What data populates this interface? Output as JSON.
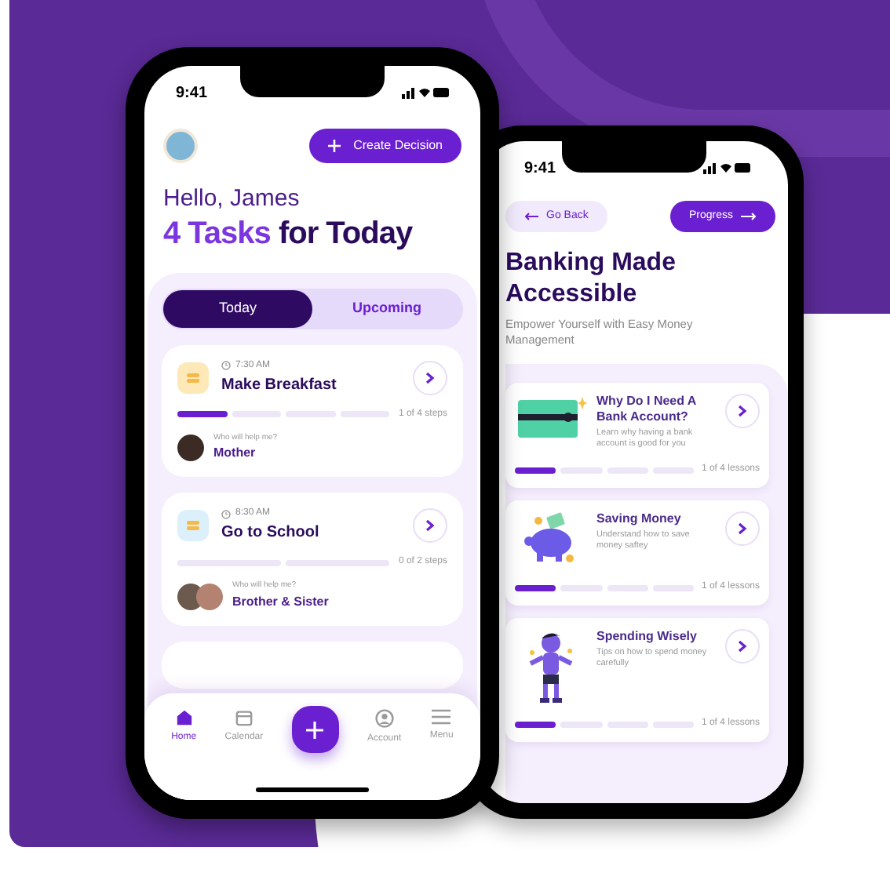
{
  "home_phone": {
    "status_time": "9:41",
    "create_button": "Create Decision",
    "greeting": "Hello, James",
    "headline_accent": "4 Tasks",
    "headline_rest": "for Today",
    "tabs": [
      {
        "label": "Today",
        "selected": true
      },
      {
        "label": "Upcoming",
        "selected": false
      }
    ],
    "tasks": [
      {
        "time": "7:30 AM",
        "title": "Make Breakfast",
        "color": "#fde9b8",
        "segments": [
          {
            "done": true
          },
          {
            "done": false
          },
          {
            "done": false
          },
          {
            "done": false
          }
        ],
        "steps": "1 of 4 steps",
        "helper_prompt": "Who will help me?",
        "helper": "Mother",
        "avatars": [
          {
            "color": "#3c2b24"
          }
        ]
      },
      {
        "time": "8:30 AM",
        "title": "Go to School",
        "color": "#dcf0fb",
        "segments": [
          {
            "done": false
          },
          {
            "done": false
          }
        ],
        "steps": "0 of 2 steps",
        "helper_prompt": "Who will help me?",
        "helper": "Brother & Sister",
        "avatars": [
          {
            "color": "#6b5a4d"
          },
          {
            "color": "#b48270"
          }
        ]
      }
    ],
    "nav": [
      {
        "kind": "home",
        "label": "Home",
        "selected": true
      },
      {
        "kind": "calendar",
        "label": "Calendar",
        "selected": false
      },
      {
        "kind": "add",
        "selected": false
      },
      {
        "kind": "account",
        "label": "Account",
        "selected": false
      },
      {
        "kind": "menu",
        "label": "Menu",
        "selected": false
      }
    ]
  },
  "banking_phone": {
    "status_time": "9:41",
    "back_button": "Go Back",
    "progress_button": "Progress",
    "title": "Banking Made Accessible",
    "subtitle": "Empower Yourself with Easy Money Management",
    "lessons": [
      {
        "kind": "card",
        "title": "Why Do I Need A Bank Account?",
        "description": "Learn why having a bank account is good for you",
        "segments": [
          {
            "done": true
          },
          {
            "done": false
          },
          {
            "done": false
          },
          {
            "done": false
          }
        ],
        "progress": "1 of 4 lessons"
      },
      {
        "kind": "piggy",
        "title": "Saving Money",
        "description": "Understand how to save money saftey",
        "segments": [
          {
            "done": true
          },
          {
            "done": false
          },
          {
            "done": false
          },
          {
            "done": false
          }
        ],
        "progress": "1 of 4 lessons"
      },
      {
        "kind": "figure",
        "title": "Spending Wisely",
        "description": "Tips on how to spend money carefully",
        "segments": [
          {
            "done": true
          },
          {
            "done": false
          },
          {
            "done": false
          },
          {
            "done": false
          }
        ],
        "progress": "1 of 4 lessons"
      }
    ]
  }
}
